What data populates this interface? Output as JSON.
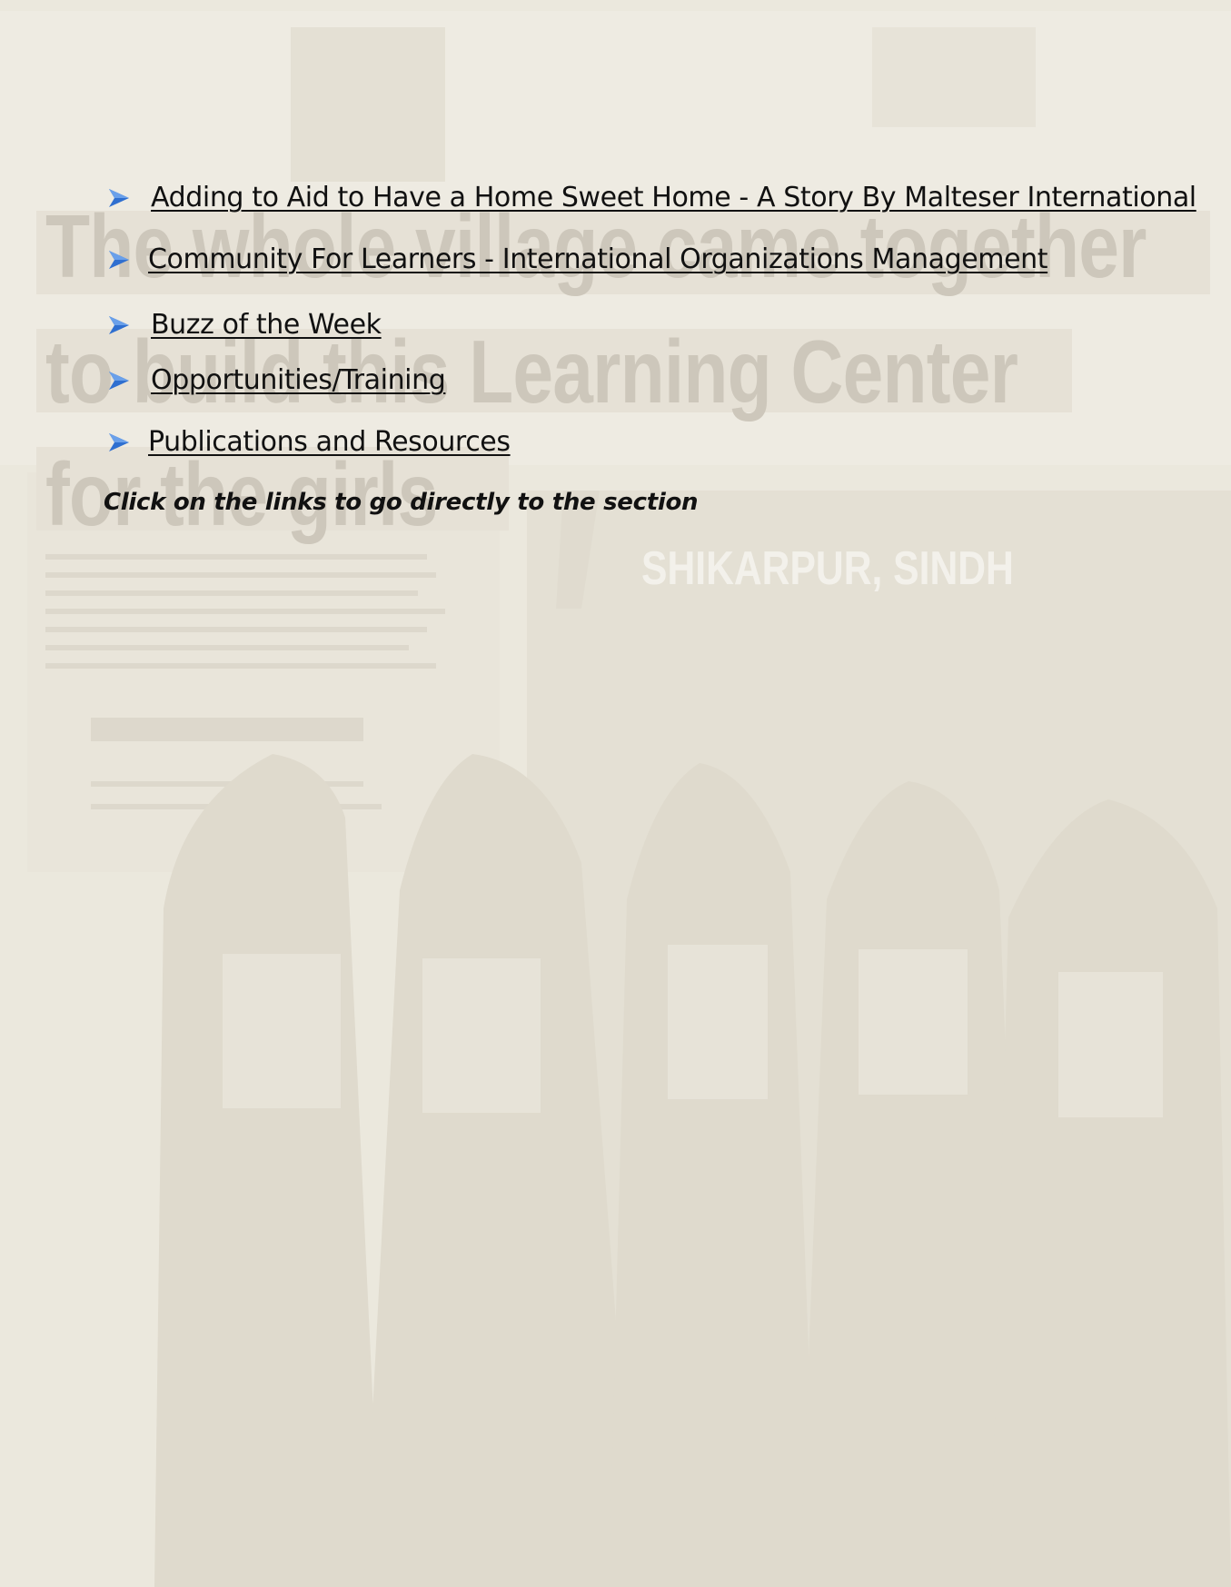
{
  "background": {
    "title_lines": [
      "The whole village came together",
      "to build this Learning Center",
      "for the girls"
    ],
    "place": "SHIKARPUR, SINDH"
  },
  "toc": {
    "items": [
      {
        "label": "Adding to Aid to Have a Home Sweet Home - A Story By Malteser International"
      },
      {
        "label": "Community For Learners - International Organizations Management"
      },
      {
        "label": "Buzz of the Week"
      },
      {
        "label": "Opportunities/Training"
      },
      {
        "label": "Publications and Resources"
      }
    ],
    "hint": "Click on the links to go directly to the section"
  },
  "colors": {
    "background": "#ebe8dd",
    "bullet_arrow": "#2f6fd0",
    "link_text": "#111111"
  },
  "icons": {
    "bullet": "arrow-bullet-icon"
  }
}
